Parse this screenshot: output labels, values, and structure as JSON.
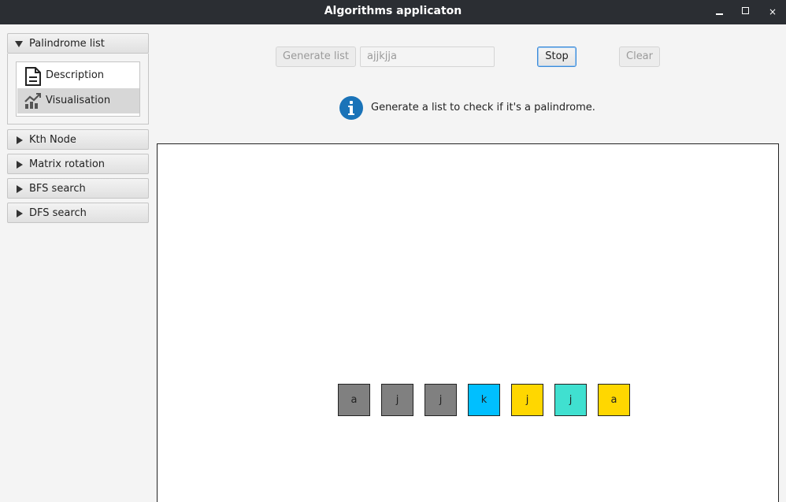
{
  "window": {
    "title": "Algorithms applicaton",
    "minimize_glyph": "",
    "maximize_glyph": "",
    "close_glyph": "×"
  },
  "sidebar": {
    "sections": [
      {
        "label": "Palindrome list",
        "expanded": true
      },
      {
        "label": "Kth Node",
        "expanded": false
      },
      {
        "label": "Matrix rotation",
        "expanded": false
      },
      {
        "label": "BFS search",
        "expanded": false
      },
      {
        "label": "DFS search",
        "expanded": false
      }
    ],
    "palindrome_items": [
      {
        "label": "Description",
        "icon": "document-icon",
        "selected": false
      },
      {
        "label": "Visualisation",
        "icon": "chart-icon",
        "selected": true
      }
    ]
  },
  "toolbar": {
    "generate_label": "Generate list",
    "input_value": "ajjkjja",
    "stop_label": "Stop",
    "clear_label": "Clear"
  },
  "info": {
    "icon": "info-icon",
    "text": "Generate a list to check if it's a palindrome."
  },
  "visualisation": {
    "cells": [
      {
        "char": "a",
        "color": "#808080"
      },
      {
        "char": "j",
        "color": "#808080"
      },
      {
        "char": "j",
        "color": "#808080"
      },
      {
        "char": "k",
        "color": "#00bfff"
      },
      {
        "char": "j",
        "color": "#ffd700"
      },
      {
        "char": "j",
        "color": "#40e0d0"
      },
      {
        "char": "a",
        "color": "#ffd700"
      }
    ]
  }
}
